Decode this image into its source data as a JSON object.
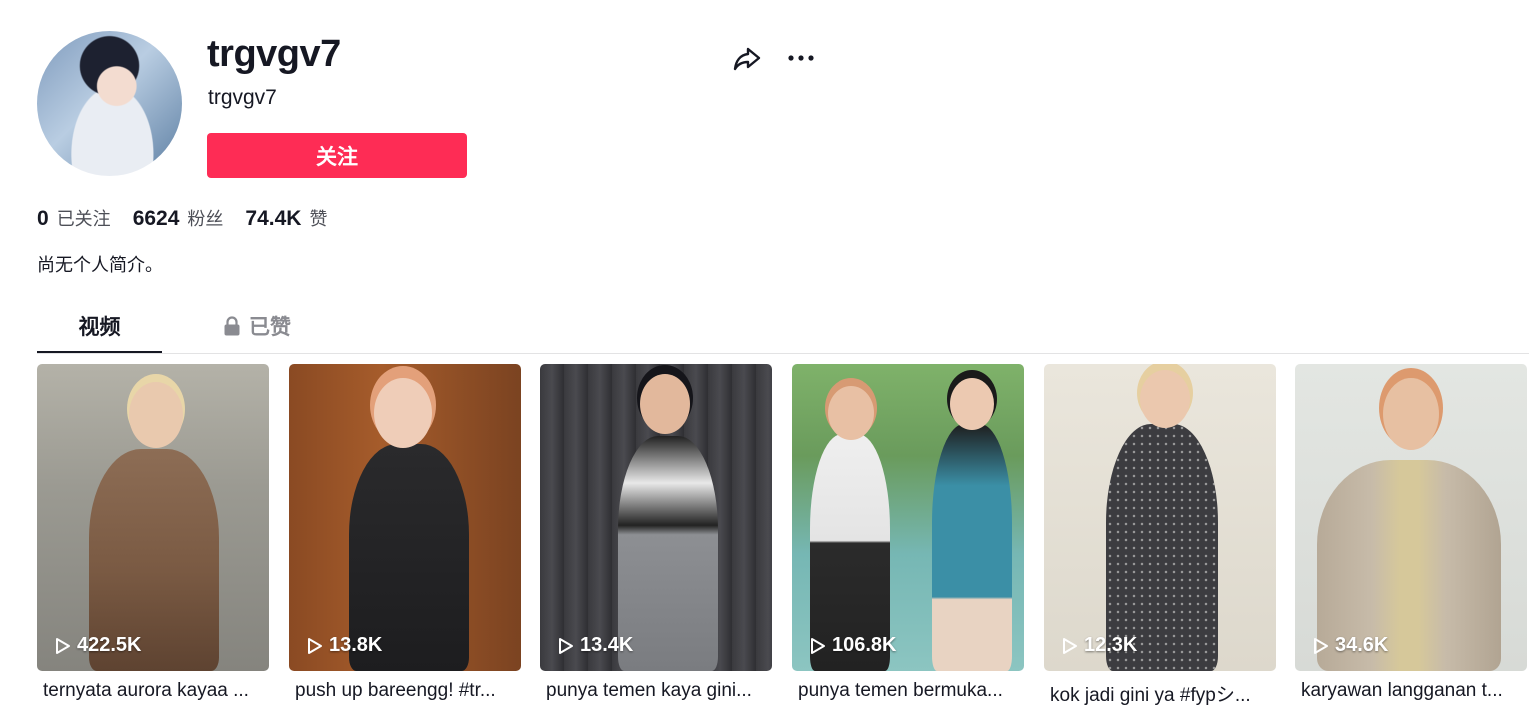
{
  "profile": {
    "username": "trgvgv7",
    "nickname": "trgvgv7",
    "follow_label": "关注",
    "bio": "尚无个人简介。"
  },
  "stats": [
    {
      "value": "0",
      "label": "已关注"
    },
    {
      "value": "6624",
      "label": "粉丝"
    },
    {
      "value": "74.4K",
      "label": "赞"
    }
  ],
  "tabs": [
    {
      "label": "视频",
      "active": true
    },
    {
      "label": "已赞",
      "locked": true
    }
  ],
  "icons": {
    "share": "share-icon",
    "more": "more-icon",
    "lock": "lock-icon",
    "play": "play-icon"
  },
  "colors": {
    "accent": "#fe2c55",
    "text": "#161823",
    "muted": "#8a8b91"
  },
  "videos": [
    {
      "views": "422.5K",
      "caption": "ternyata aurora kayaa ..."
    },
    {
      "views": "13.8K",
      "caption": "push up bareengg! #tr..."
    },
    {
      "views": "13.4K",
      "caption": "punya temen kaya gini..."
    },
    {
      "views": "106.8K",
      "caption": "punya temen bermuka..."
    },
    {
      "views": "12.3K",
      "caption": "kok jadi gini ya #fypシ..."
    },
    {
      "views": "34.6K",
      "caption": "karyawan langganan t..."
    }
  ]
}
